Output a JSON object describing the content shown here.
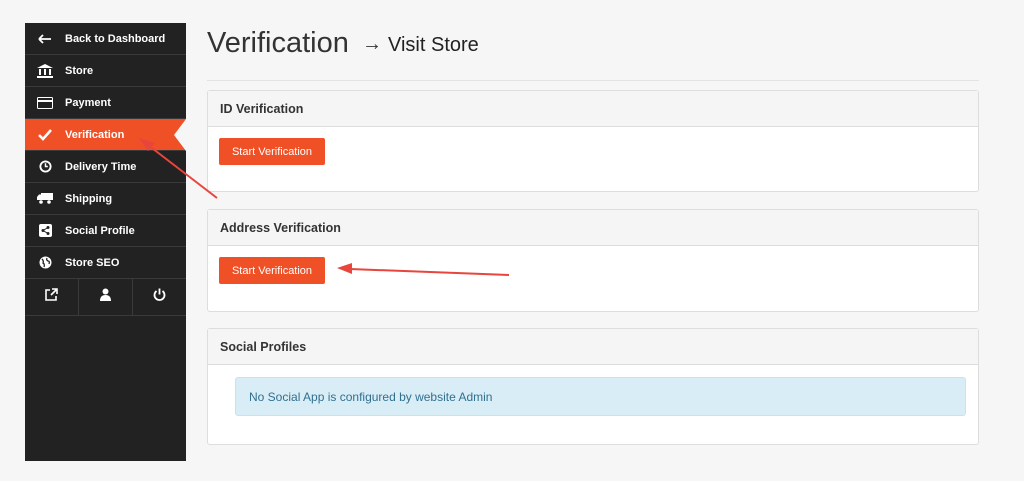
{
  "sidebar": {
    "items": [
      {
        "label": "Back to Dashboard",
        "icon": "arrow-left-icon"
      },
      {
        "label": "Store",
        "icon": "bank-icon"
      },
      {
        "label": "Payment",
        "icon": "credit-card-icon"
      },
      {
        "label": "Verification",
        "icon": "check-icon"
      },
      {
        "label": "Delivery Time",
        "icon": "clock-icon"
      },
      {
        "label": "Shipping",
        "icon": "truck-icon"
      },
      {
        "label": "Social Profile",
        "icon": "share-icon"
      },
      {
        "label": "Store SEO",
        "icon": "globe-icon"
      }
    ],
    "active_item": "Verification",
    "bottom_icons": [
      "external-link-icon",
      "user-icon",
      "power-icon"
    ]
  },
  "header": {
    "title": "Verification",
    "arrow": "→",
    "link": "Visit Store"
  },
  "panels": {
    "id_verification": {
      "title": "ID Verification",
      "button": "Start Verification"
    },
    "address_verification": {
      "title": "Address Verification",
      "button": "Start Verification"
    },
    "social_profiles": {
      "title": "Social Profiles",
      "message": "No Social App is configured by website Admin"
    }
  },
  "colors": {
    "accent": "#f05025",
    "sidebar_bg": "#222222",
    "annotation_arrow": "#e8453c",
    "info_bg": "#d9edf7",
    "info_text": "#31708f"
  }
}
